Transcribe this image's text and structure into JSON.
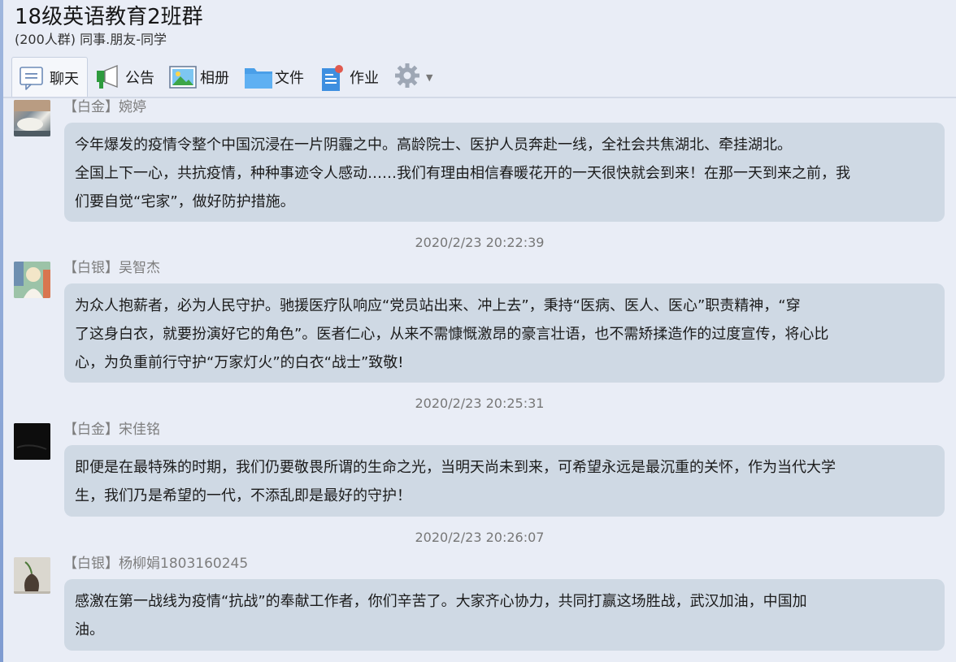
{
  "window": {
    "title": "18级英语教育2班群",
    "subtitle": "(200人群) 同事.朋友-同学"
  },
  "toolbar": {
    "items": [
      {
        "label": "聊天",
        "icon": "chat-icon",
        "active": true
      },
      {
        "label": "公告",
        "icon": "announcement-icon"
      },
      {
        "label": "相册",
        "icon": "album-icon"
      },
      {
        "label": "文件",
        "icon": "folder-icon"
      },
      {
        "label": "作业",
        "icon": "homework-icon",
        "badge": true
      }
    ],
    "settings_icon": "gear-icon"
  },
  "colors": {
    "bubble": "#cfd9e4",
    "background": "#e9edf6",
    "badge": "#e05a4f",
    "folder": "#4a9fe8"
  },
  "messages": [
    {
      "sender": "【白金】婉婷",
      "lines": [
        "今年爆发的疫情令整个中国沉浸在一片阴霾之中。高龄院士、医护人员奔赴一线，全社会共焦湖北、牵挂湖北。",
        "全国上下一心，共抗疫情，种种事迹令人感动……我们有理由相信春暖花开的一天很快就会到来！在那一天到来之前，我",
        "们要自觉“宅家”，做好防护措施。"
      ]
    },
    {
      "timestamp": "2020/2/23 20:22:39",
      "sender": "【白银】吴智杰",
      "lines": [
        "为众人抱薪者，必为人民守护。驰援医疗队响应“党员站出来、冲上去”，秉持“医病、医人、医心”职责精神，“穿",
        "了这身白衣，就要扮演好它的角色”。医者仁心，从来不需慷慨激昂的豪言壮语，也不需矫揉造作的过度宣传，将心比",
        "心，为负重前行守护“万家灯火”的白衣“战士”致敬!"
      ]
    },
    {
      "timestamp": "2020/2/23 20:25:31",
      "sender": "【白金】宋佳铭",
      "lines": [
        "即便是在最特殊的时期，我们仍要敬畏所谓的生命之光，当明天尚未到来，可希望永远是最沉重的关怀，作为当代大学",
        "生，我们乃是希望的一代，不添乱即是最好的守护！"
      ]
    },
    {
      "timestamp": "2020/2/23 20:26:07",
      "sender": "【白银】杨柳娟1803160245",
      "lines": [
        "感激在第一战线为疫情“抗战”的奉献工作者，你们辛苦了。大家齐心协力，共同打赢这场胜战，武汉加油，中国加",
        "油。"
      ]
    }
  ]
}
